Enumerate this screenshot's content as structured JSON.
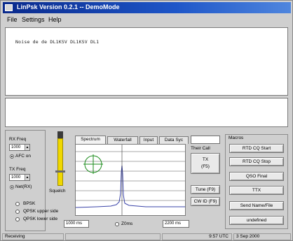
{
  "window": {
    "title": "LinPsk Version 0.2.1 -- DemoMode"
  },
  "menu": [
    "File",
    "Settings",
    "Help"
  ],
  "rx_text": "Noise de de DL1KSV DL1KSV DL1",
  "rx_freq": {
    "label": "RX Freq",
    "value": "1000",
    "afc_label": "AFC on"
  },
  "tx_freq": {
    "label": "TX Freq",
    "value": "1000",
    "net_label": "Net(RX)"
  },
  "squelch_label": "Squelch",
  "modes": [
    "BPSK",
    "QPSK upper side",
    "QPSK lower side"
  ],
  "tabs": [
    "Spectrum",
    "Waterfall",
    "Input",
    "Data Syc"
  ],
  "tabs_field": "",
  "spectrum": {
    "time_value": "1000 ms",
    "radio_label": "Z0ms",
    "right_value": "2200 ms"
  },
  "controls": {
    "their_call_label": "Their Call",
    "tx_button": "TX (F5)",
    "tune_button": "Tune (F9)",
    "cw_id_button": "CW ID (F9)"
  },
  "macros": {
    "group_label": "Macros",
    "buttons": [
      "RTD CQ Start",
      "RTD CQ Stop",
      "QSO Final",
      "TTX",
      "Send Name/File",
      "undefined"
    ]
  },
  "status": {
    "state": "Receiving",
    "value": "",
    "time": "9:57 UTC",
    "date": "3 Sep 2000"
  }
}
